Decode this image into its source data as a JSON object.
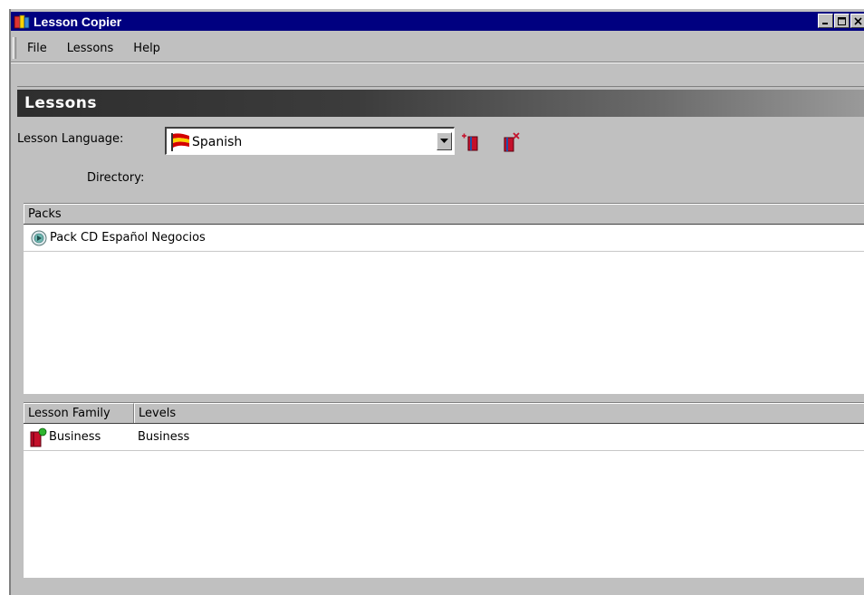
{
  "window": {
    "title": "Lesson Copier",
    "controls": [
      "minimize",
      "maximize",
      "close"
    ]
  },
  "menu": {
    "items": [
      "File",
      "Lessons",
      "Help"
    ]
  },
  "section": {
    "title": "Lessons"
  },
  "language": {
    "label": "Lesson Language:",
    "selected": "Spanish",
    "flag_icon": "spain-flag-icon",
    "directory_label": "Directory:"
  },
  "toolbar": {
    "icons": [
      "add-lesson-icon",
      "remove-lesson-icon"
    ]
  },
  "packs": {
    "header": "Packs",
    "items": [
      {
        "icon": "cd-disc-icon",
        "label": "Pack CD Español Negocios"
      }
    ]
  },
  "lessons": {
    "columns": [
      "Lesson Family",
      "Levels"
    ],
    "rows": [
      {
        "icon": "book-icon",
        "family": "Business",
        "levels": "Business"
      }
    ]
  },
  "colors": {
    "titlebar": "#000080",
    "chrome": "#c0c0c0",
    "header_gradient_dark": "#2e2e2e",
    "header_gradient_light": "#9a9a9a"
  }
}
